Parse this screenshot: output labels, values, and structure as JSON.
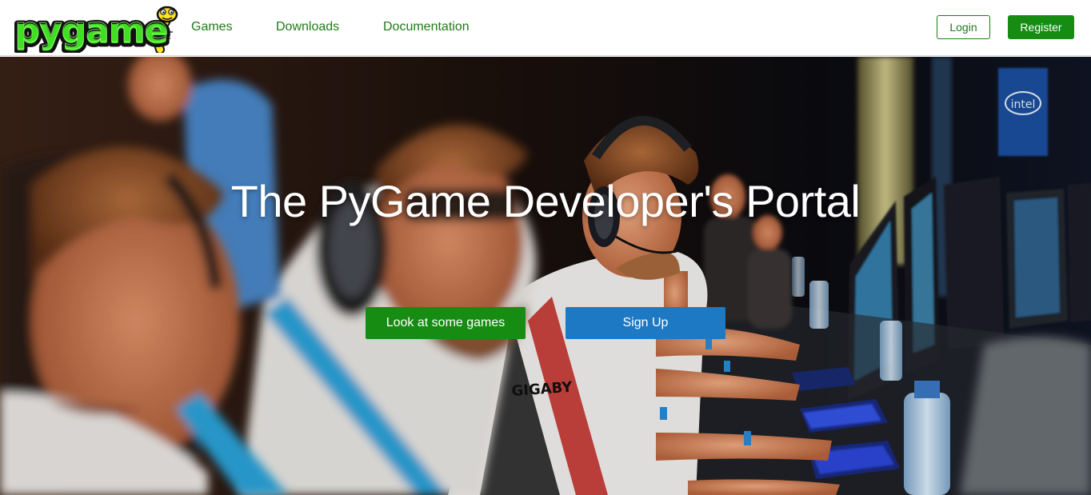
{
  "brand": {
    "logo_text": "pygame",
    "logo_fill": "#3fe021",
    "logo_outline": "#111111",
    "snake_color": "#ffe31c"
  },
  "nav": {
    "items": [
      {
        "label": "Games"
      },
      {
        "label": "Downloads"
      },
      {
        "label": "Documentation"
      }
    ],
    "login_label": "Login",
    "register_label": "Register",
    "link_color": "#1e7a16",
    "primary_color": "#168c13"
  },
  "hero": {
    "title": "The PyGame Developer's Portal",
    "primary_cta": "Look at some games",
    "secondary_cta": "Sign Up",
    "secondary_color": "#1d79c4",
    "background_image": "photo of gamers wearing headsets playing at a row of computers",
    "photo_text": {
      "shirt_sponsor": "GIGABYTE",
      "banner": "intel"
    }
  }
}
